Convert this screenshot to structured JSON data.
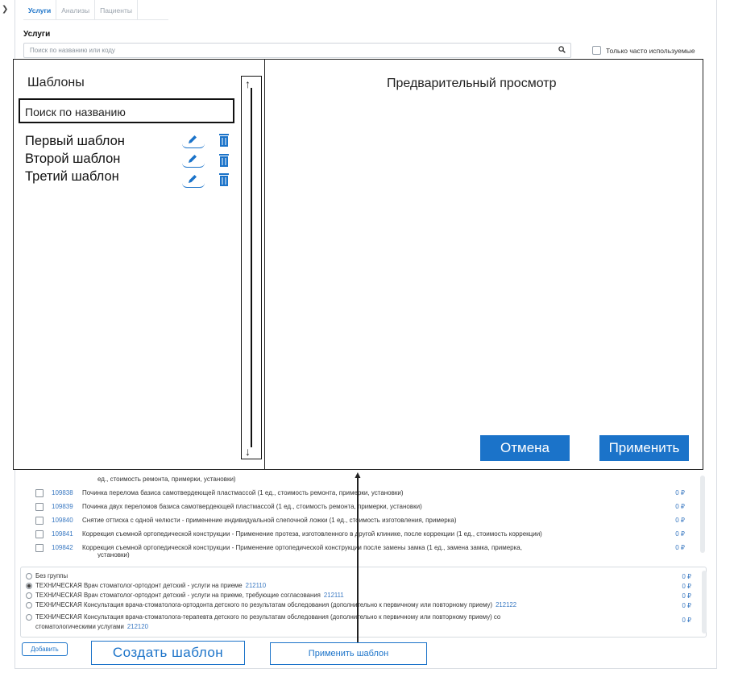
{
  "tabs": [
    {
      "label": "Услуги"
    },
    {
      "label": "Анализы"
    },
    {
      "label": "Пациенты"
    }
  ],
  "services": {
    "title": "Услуги",
    "search_placeholder": "Поиск по названию или коду",
    "only_frequent_label": "Только часто используемые",
    "partial_row_text": "ед., стоимость ремонта, примерки, установки)",
    "rows": [
      {
        "code": "109838",
        "text": "Починка перелома базиса самотвердеющей пластмассой (1 ед., стоимость ремонта, примерки, установки)",
        "price": "0 ₽"
      },
      {
        "code": "109839",
        "text": "Починка двух переломов базиса самотвердеющей пластмассой (1 ед., стоимость ремонта, примерки, установки)",
        "price": "0 ₽"
      },
      {
        "code": "109840",
        "text": "Снятие оттиска с одной челюсти - применение индивидуальной слепочной ложки (1 ед., стоимость изготовления, примерка)",
        "price": "0 ₽"
      },
      {
        "code": "109841",
        "text": "Коррекция съемной ортопедической конструкции - Применение протеза, изготовленного в другой клинике, после коррекции (1 ед., стоимость коррекции)",
        "price": "0 ₽"
      },
      {
        "code": "109842",
        "text": "Коррекция съемной ортопедической конструкции - Применение ортопедической конструкции после замены замка (1 ед., замена замка, примерка,",
        "price": "0 ₽"
      }
    ],
    "last_row_wrap": "установки)"
  },
  "groups": [
    {
      "text": "Без группы",
      "code": "",
      "price": "0 ₽",
      "selected": false
    },
    {
      "text": "ТЕХНИЧЕСКАЯ Врач стоматолог-ортодонт детский - услуги на приеме",
      "code": "212110",
      "price": "0 ₽",
      "selected": true
    },
    {
      "text": "ТЕХНИЧЕСКАЯ Врач стоматолог-ортодонт детский - услуги на приеме, требующие согласования",
      "code": "212111",
      "price": "0 ₽",
      "selected": false
    },
    {
      "text": "ТЕХНИЧЕСКАЯ Консультация врача-стоматолога-ортодонта детского по результатам обследования (дополнительно к первичному или повторному приему)",
      "code": "212122",
      "price": "0 ₽",
      "selected": false
    },
    {
      "text": "ТЕХНИЧЕСКАЯ Консультация врача-стоматолога-терапевта детского по результатам обследования (дополнительно к первичному или повторному приему) со",
      "code": "",
      "price": "0 ₽",
      "selected": false
    }
  ],
  "groups_wrap": {
    "text": "стоматологическими услугами",
    "code": "212120"
  },
  "buttons": {
    "add": "Добавить",
    "create_template": "Создать шаблон",
    "apply_template": "Применить шаблон"
  },
  "modal": {
    "templates_title": "Шаблоны",
    "search_placeholder": "Поиск по названию",
    "templates": [
      {
        "name": "Первый шаблон"
      },
      {
        "name": "Второй шаблон"
      },
      {
        "name": "Третий шаблон"
      }
    ],
    "preview_title": "Предварительный просмотр",
    "cancel": "Отмена",
    "apply": "Применить"
  },
  "colors": {
    "accent": "#1b73c9",
    "link": "#3a79c2",
    "border": "#222222"
  }
}
